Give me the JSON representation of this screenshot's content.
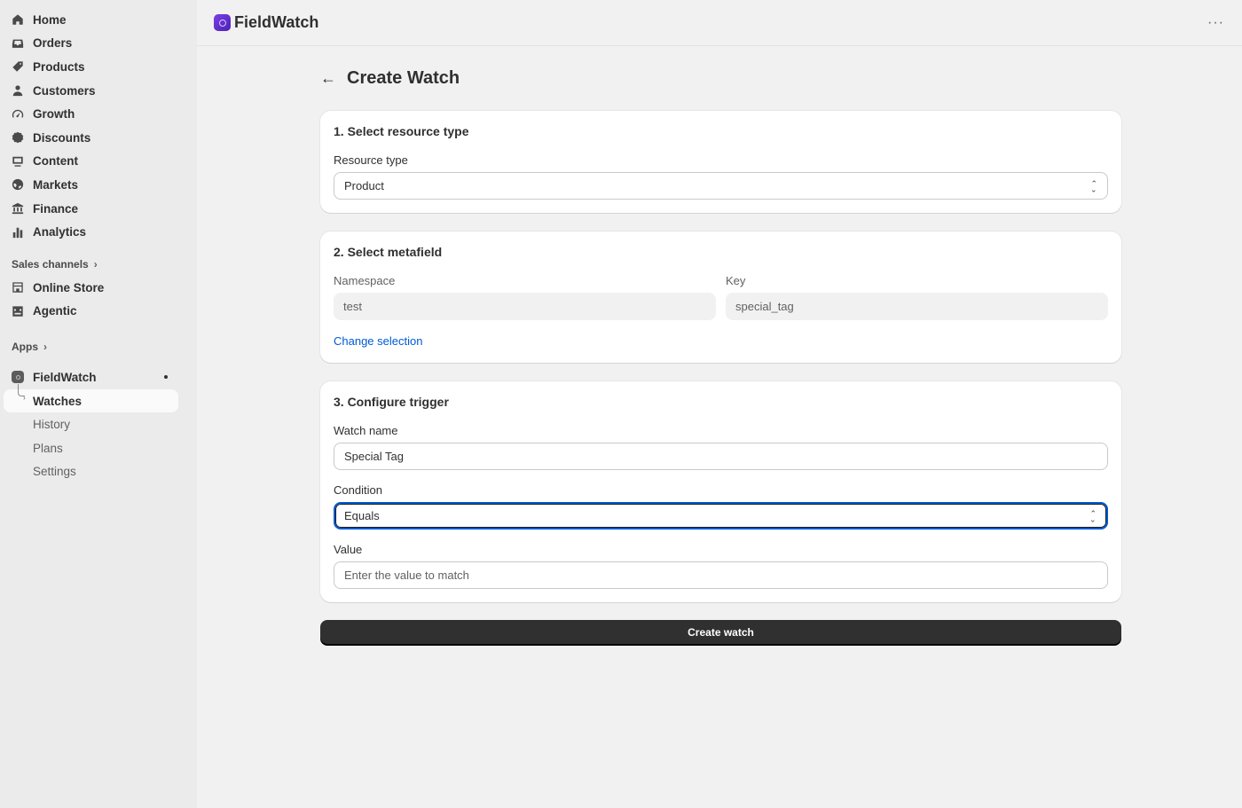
{
  "sidebar": {
    "items": [
      {
        "label": "Home",
        "icon": "home-icon"
      },
      {
        "label": "Orders",
        "icon": "inbox-icon"
      },
      {
        "label": "Products",
        "icon": "tag-icon"
      },
      {
        "label": "Customers",
        "icon": "person-icon"
      },
      {
        "label": "Growth",
        "icon": "gauge-icon"
      },
      {
        "label": "Discounts",
        "icon": "discount-icon"
      },
      {
        "label": "Content",
        "icon": "content-icon"
      },
      {
        "label": "Markets",
        "icon": "globe-icon"
      },
      {
        "label": "Finance",
        "icon": "bank-icon"
      },
      {
        "label": "Analytics",
        "icon": "bar-chart-icon"
      }
    ],
    "sales_channels": {
      "heading": "Sales channels",
      "items": [
        {
          "label": "Online Store",
          "icon": "store-icon"
        },
        {
          "label": "Agentic",
          "icon": "robot-icon"
        }
      ]
    },
    "apps": {
      "heading": "Apps",
      "app_name": "FieldWatch",
      "sub_items": [
        {
          "label": "Watches",
          "active": true
        },
        {
          "label": "History"
        },
        {
          "label": "Plans"
        },
        {
          "label": "Settings"
        }
      ]
    }
  },
  "topbar": {
    "app_title": "FieldWatch",
    "more": "···"
  },
  "page": {
    "title": "Create Watch",
    "back": "←"
  },
  "step1": {
    "heading": "1. Select resource type",
    "resource_label": "Resource type",
    "resource_value": "Product"
  },
  "step2": {
    "heading": "2. Select metafield",
    "namespace_label": "Namespace",
    "namespace_value": "test",
    "key_label": "Key",
    "key_value": "special_tag",
    "change_link": "Change selection"
  },
  "step3": {
    "heading": "3. Configure trigger",
    "watch_name_label": "Watch name",
    "watch_name_value": "Special Tag",
    "condition_label": "Condition",
    "condition_value": "Equals",
    "value_label": "Value",
    "value_placeholder": "Enter the value to match"
  },
  "submit_label": "Create watch",
  "colors": {
    "accent": "#005bd3",
    "primary_button": "#303030",
    "logo": "#6a31d8"
  }
}
